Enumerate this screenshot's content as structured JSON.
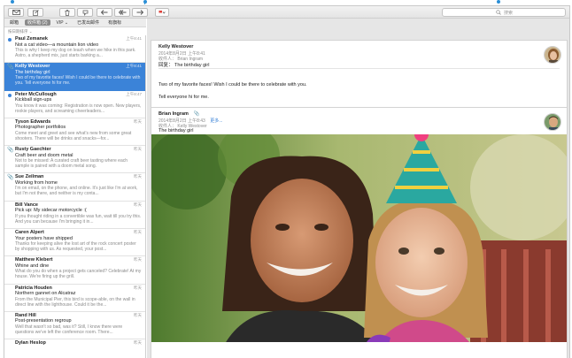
{
  "toolbar": {
    "search_placeholder": "搜索"
  },
  "favorites": {
    "items": [
      {
        "label": "邮箱"
      },
      {
        "label": "收件箱 (2)",
        "active": true
      },
      {
        "label": "VIP ⌄"
      },
      {
        "label": "已发出邮件"
      },
      {
        "label": "有旗标"
      }
    ]
  },
  "sort_label": "按日期排序 ⌄",
  "messages": [
    {
      "from": "Paul Zemanek",
      "time": "上午8:41",
      "subject": "Not a cat video—a mountain lion video",
      "preview": "This is why I keep my dog on leash when we hike in this park. Astro, a shepherd mix, just starts barking a...",
      "unread": true,
      "attachment": true
    },
    {
      "from": "Kelly Westover",
      "time": "上午8:41",
      "subject": "The birthday girl",
      "preview": "Two of my favorite faces! Wish I could be there to celebrate with you. Tell everyone hi for me.",
      "selected": true,
      "attachment": true
    },
    {
      "from": "Peter McCullough",
      "time": "上午8:47",
      "subject": "Kickball sign-ups",
      "preview": "You know it was coming: Registration is now open. New players, rookie players, and screaming cheerleaders...",
      "unread": true
    },
    {
      "from": "Tyson Edwards",
      "time": "昨天",
      "subject": "Photographer portfolios",
      "preview": "Come meet and greet and see what's new from some great shooters. There will be drinks and snacks—for..."
    },
    {
      "from": "Rusty Gaechter",
      "time": "昨天",
      "subject": "Craft beer and doom metal",
      "preview": "Not to be missed: A curated craft beer tasting where each sample is paired with a doom metal song.",
      "attachment": true
    },
    {
      "from": "Sue Zeilman",
      "time": "昨天",
      "subject": "Working from home",
      "preview": "I'm on email, on the phone, and online. It's just like I'm at work, but I'm not there, and neither is my conta...",
      "attachment": true
    },
    {
      "from": "Bill Vance",
      "time": "昨天",
      "subject": "Pick up: My sidecar motorcycle :(",
      "preview": "If you thought riding in a convertible was fun, wait till you try this. And you can because I'm bringing it in..."
    },
    {
      "from": "Caren Alpert",
      "time": "昨天",
      "subject": "Your posters have shipped",
      "preview": "Thanks for keeping alive the lost art of the rock concert poster by shopping with us. As requested, your post..."
    },
    {
      "from": "Matthew Klebert",
      "time": "昨天",
      "subject": "Whine and dine",
      "preview": "What do you do when a project gets canceled? Celebrate! At my house. We're firing up the grill."
    },
    {
      "from": "Patricia Houden",
      "time": "昨天",
      "subject": "Northern gannet on Alcatraz",
      "preview": "From the Municipal Pier, this bird is scope-able, on the wall in direct line with the lighthouse. Could it be the..."
    },
    {
      "from": "Rand Hill",
      "time": "昨天",
      "subject": "Post-presentation regroup",
      "preview": "Well that wasn't so bad, was it? Still, I know there were questions we've left the conference room. There..."
    },
    {
      "from": "Dylan Heslop",
      "time": "昨天",
      "subject": "",
      "preview": ""
    }
  ],
  "reading": {
    "message1": {
      "from": "Kelly Westover",
      "date": "2014年8月2日 上午8:41",
      "to": "收件人： Brian Ingram",
      "subject": "回复： The birthday girl",
      "body1": "Two of my favorite faces! Wish I could be there to celebrate with you.",
      "body2": "Tell everyone hi for me."
    },
    "message2": {
      "from": "Brian Ingram",
      "date": "2014年8月2日 上午8:43",
      "details": "更多...",
      "to": "收件人： Kelly Westover",
      "subject": "The birthday girl"
    }
  }
}
